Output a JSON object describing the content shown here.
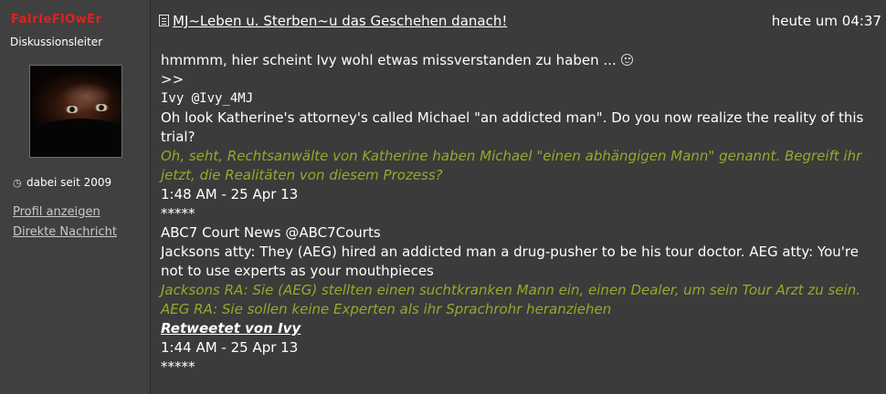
{
  "author": {
    "name": "FaIrIeFlOwEr",
    "rank": "Diskussionsleiter",
    "member_since": "dabei seit 2009",
    "member_since_icon": "user-icon",
    "links": {
      "profile": "Profil anzeigen",
      "message": "Direkte Nachricht"
    }
  },
  "post": {
    "title_icon": "document-icon",
    "title": "MJ~Leben u. Sterben~u das Geschehen danach!",
    "date": "heute um 04:37",
    "lines": {
      "intro": "hmmmm, hier scheint Ivy wohl etwas missverstanden zu haben ...",
      "intro_icon": "smiley-icon",
      "quote_marker": ">>",
      "tweet1_user": "Ivy @Ivy_4MJ",
      "tweet1_text": "Oh look Katherine's attorney's called Michael \"an addicted man\". Do you now realize the reality of this trial?",
      "tweet1_translation": "Oh, seht, Rechtsanwälte von Katherine haben Michael \"einen abhängigen Mann\" genannt. Begreift ihr jetzt, die Realitäten von diesem Prozess?",
      "tweet1_time": "1:48 AM - 25 Apr 13",
      "separator1": "*****",
      "tweet2_user": "ABC7 Court News @ABC7Courts",
      "tweet2_text": "Jacksons atty: They (AEG) hired an addicted man a drug-pusher to be his tour doctor. AEG atty: You're not to use experts as your mouthpieces",
      "tweet2_translation_1": "Jacksons RA: Sie (AEG) stellten einen suchtkranken Mann ein, einen Dealer, um sein Tour Arzt zu sein.",
      "tweet2_translation_2": "AEG RA: Sie sollen keine Experten als ihr Sprachrohr heranziehen",
      "retweet": "Retweetet von Ivy",
      "tweet2_time": "1:44 AM - 25 Apr 13",
      "separator2": "*****"
    }
  },
  "colors": {
    "username": "#e2211b",
    "translation": "#9aa72a",
    "background": "#3b3b3b",
    "sidebar": "#404040"
  }
}
